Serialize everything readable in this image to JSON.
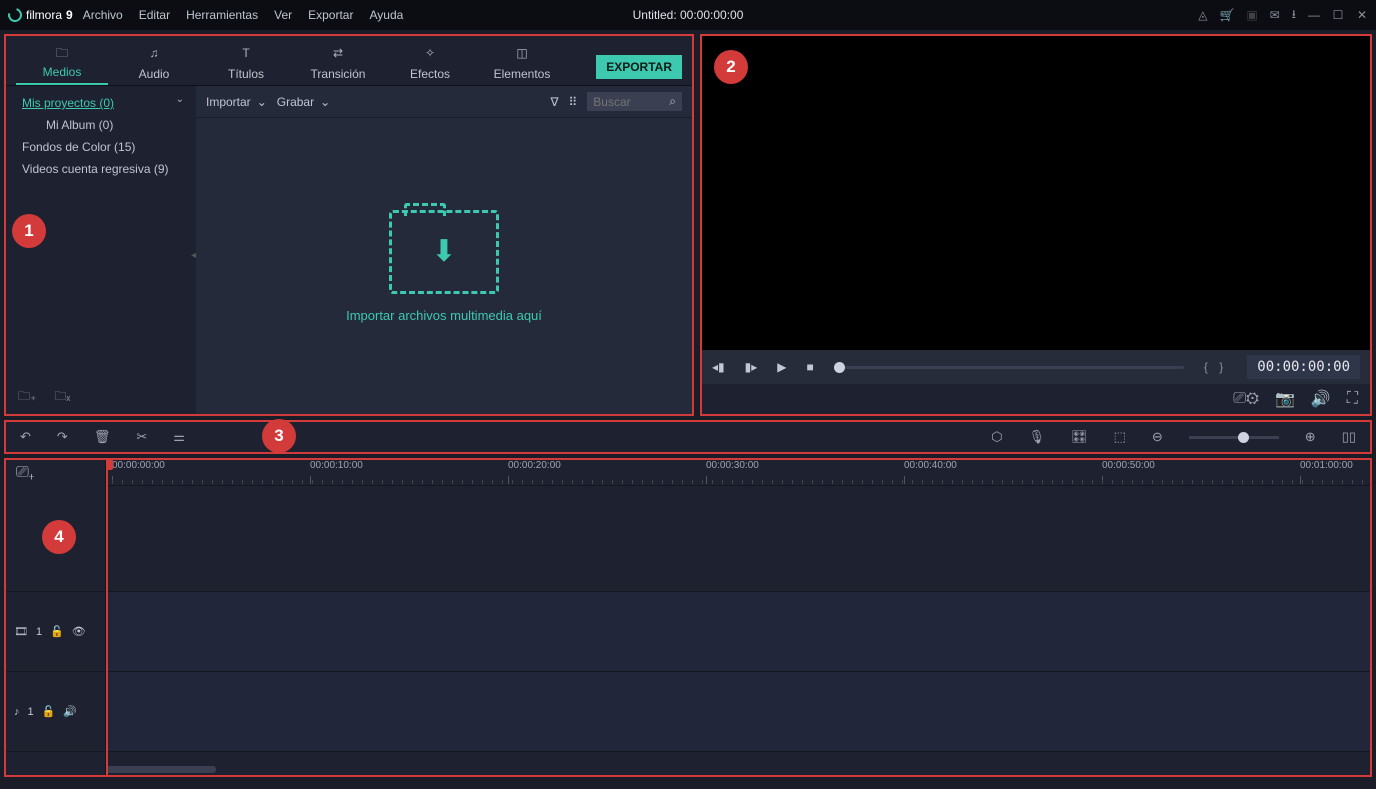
{
  "app": {
    "name": "filmora",
    "version": "9"
  },
  "menus": [
    "Archivo",
    "Editar",
    "Herramientas",
    "Ver",
    "Exportar",
    "Ayuda"
  ],
  "title_center": "Untitled:  00:00:00:00",
  "media_tabs": [
    {
      "label": "Medios",
      "active": true
    },
    {
      "label": "Audio"
    },
    {
      "label": "Títulos"
    },
    {
      "label": "Transición"
    },
    {
      "label": "Efectos"
    },
    {
      "label": "Elementos"
    }
  ],
  "export_label": "EXPORTAR",
  "tree": {
    "items": [
      {
        "label": "Mis proyectos (0)",
        "sel": true
      },
      {
        "label": "Mi Album (0)",
        "sub": true
      },
      {
        "label": "Fondos de Color (15)"
      },
      {
        "label": "Videos cuenta regresiva (9)"
      }
    ]
  },
  "mc_toolbar": {
    "import": "Importar",
    "record": "Grabar",
    "search_placeholder": "Buscar"
  },
  "drop_hint": "Importar archivos multimedia aquí",
  "preview": {
    "time": "00:00:00:00"
  },
  "timeline": {
    "ruler": [
      "00:00:00:00",
      "00:00:10:00",
      "00:00:20:00",
      "00:00:30:00",
      "00:00:40:00",
      "00:00:50:00",
      "00:01:00:00"
    ],
    "video_track": "1",
    "audio_track": "1"
  },
  "callouts": {
    "media": "1",
    "preview": "2",
    "toolbar": "3",
    "timeline": "4"
  }
}
